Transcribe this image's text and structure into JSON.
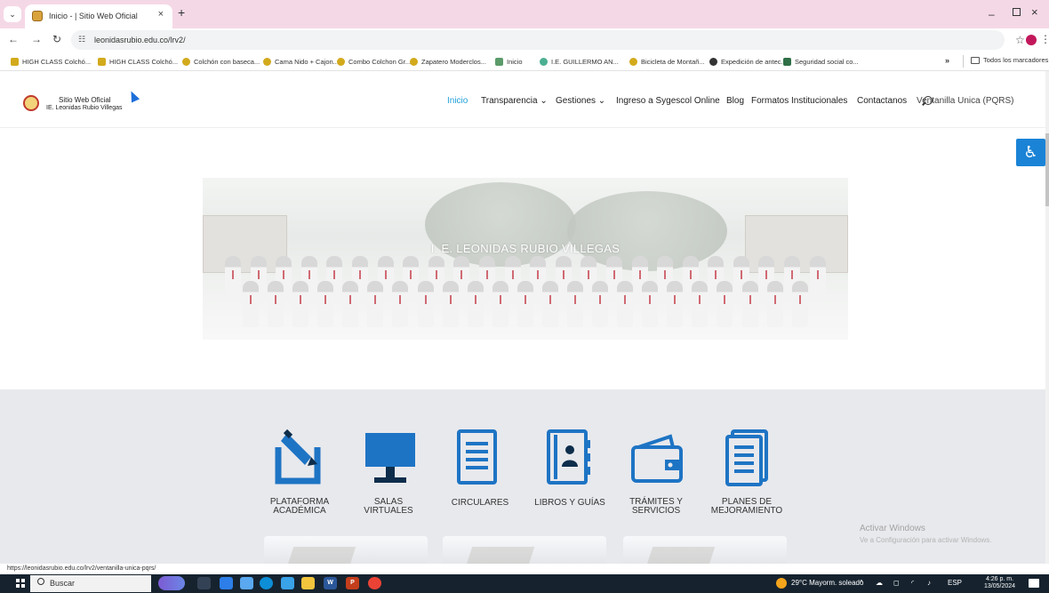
{
  "colors": {
    "tab_strip": "#f5d8e6",
    "nav_active": "#1e9fd9",
    "icon_blue": "#1e74c4",
    "accessibility": "#1a83d6",
    "section_bg": "#e8e9ed",
    "taskbar": "#16232f"
  },
  "browser": {
    "tab_title": "Inicio - | Sitio Web Oficial",
    "url": "leonidasrubio.edu.co/lrv2/",
    "bookmarks": [
      "HIGH CLASS Colchó...",
      "HIGH CLASS Colchó...",
      "Colchón con baseca...",
      "Cama Nido + Cajon...",
      "Combo Colchon Gr...",
      "Zapatero Moderclos...",
      "Inicio",
      "I.E. GUILLERMO AN...",
      "Bicicleta de Montañ...",
      "Expedición de antec...",
      "Seguridad social co..."
    ],
    "bookmarks_folder": "Todos los marcadores",
    "status_url": "https://leonidasrubio.edu.co/lrv2/ventanilla-unica-pqrs/"
  },
  "site": {
    "brand_line1": "Sitio Web Oficial",
    "brand_line2": "IE. Leonidas Rubio Villegas",
    "nav": [
      "Inicio",
      "Transparencia ⌄",
      "Gestiones ⌄",
      "Ingreso a Sygescol Online",
      "Blog",
      "Formatos Institucionales",
      "Contactanos",
      "Ventanilla Unica (PQRS)"
    ],
    "hero_title": "I. E. LEONIDAS RUBIO VILLEGAS",
    "services": [
      {
        "icon": "pencil-tablet-icon",
        "label1": "PLATAFORMA",
        "label2": "ACADÉMICA"
      },
      {
        "icon": "monitor-icon",
        "label1": "SALAS",
        "label2": "VIRTUALES"
      },
      {
        "icon": "document-icon",
        "label1": "CIRCULARES",
        "label2": ""
      },
      {
        "icon": "contact-book-icon",
        "label1": "LIBROS Y GUÍAS",
        "label2": ""
      },
      {
        "icon": "wallet-icon",
        "label1": "TRÁMITES Y",
        "label2": "SERVICIOS"
      },
      {
        "icon": "document-list-icon",
        "label1": "PLANES DE",
        "label2": "MEJORAMIENTO"
      }
    ]
  },
  "windows_notice": {
    "line1": "Activar Windows",
    "line2": "Ve a Configuración para activar Windows."
  },
  "taskbar": {
    "search_placeholder": "Buscar",
    "weather": "29°C  Mayorm. soleado",
    "lang": "ESP",
    "time": "4:26 p. m.",
    "date": "13/05/2024"
  }
}
